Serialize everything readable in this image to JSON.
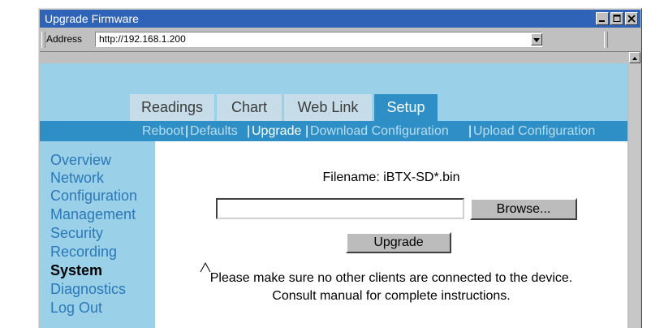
{
  "window": {
    "title": "Upgrade Firmware"
  },
  "address_bar": {
    "label": "Address",
    "url": "http://192.168.1.200"
  },
  "tabs": [
    {
      "label": "Readings",
      "active": false
    },
    {
      "label": "Chart",
      "active": false
    },
    {
      "label": "Web Link",
      "active": false
    },
    {
      "label": "Setup",
      "active": true
    }
  ],
  "subnav": {
    "items": [
      "Reboot",
      "Defaults",
      "Upgrade",
      "Download Configuration",
      "Upload Configuration"
    ],
    "separator": "|",
    "current": "Upgrade"
  },
  "sidebar": {
    "items": [
      {
        "label": "Overview"
      },
      {
        "label": "Network"
      },
      {
        "label": "Configuration"
      },
      {
        "label": "Management"
      },
      {
        "label": "Security"
      },
      {
        "label": "Recording"
      },
      {
        "label": "System",
        "current": true
      },
      {
        "label": "Diagnostics"
      },
      {
        "label": "Log Out"
      }
    ]
  },
  "upgrade_form": {
    "filename_text": "Filename: iBTX-SD*.bin",
    "file_value": "",
    "browse_label": "Browse...",
    "upgrade_label": "Upgrade",
    "message_line1": "Please make sure no other clients are connected to the device.",
    "message_line2": "Consult manual for complete instructions."
  },
  "colors": {
    "title_bar": "#2f63b8",
    "page_bg": "#9ad0e8",
    "nav_bar": "#2e8fc7",
    "link": "#2b78b8"
  }
}
